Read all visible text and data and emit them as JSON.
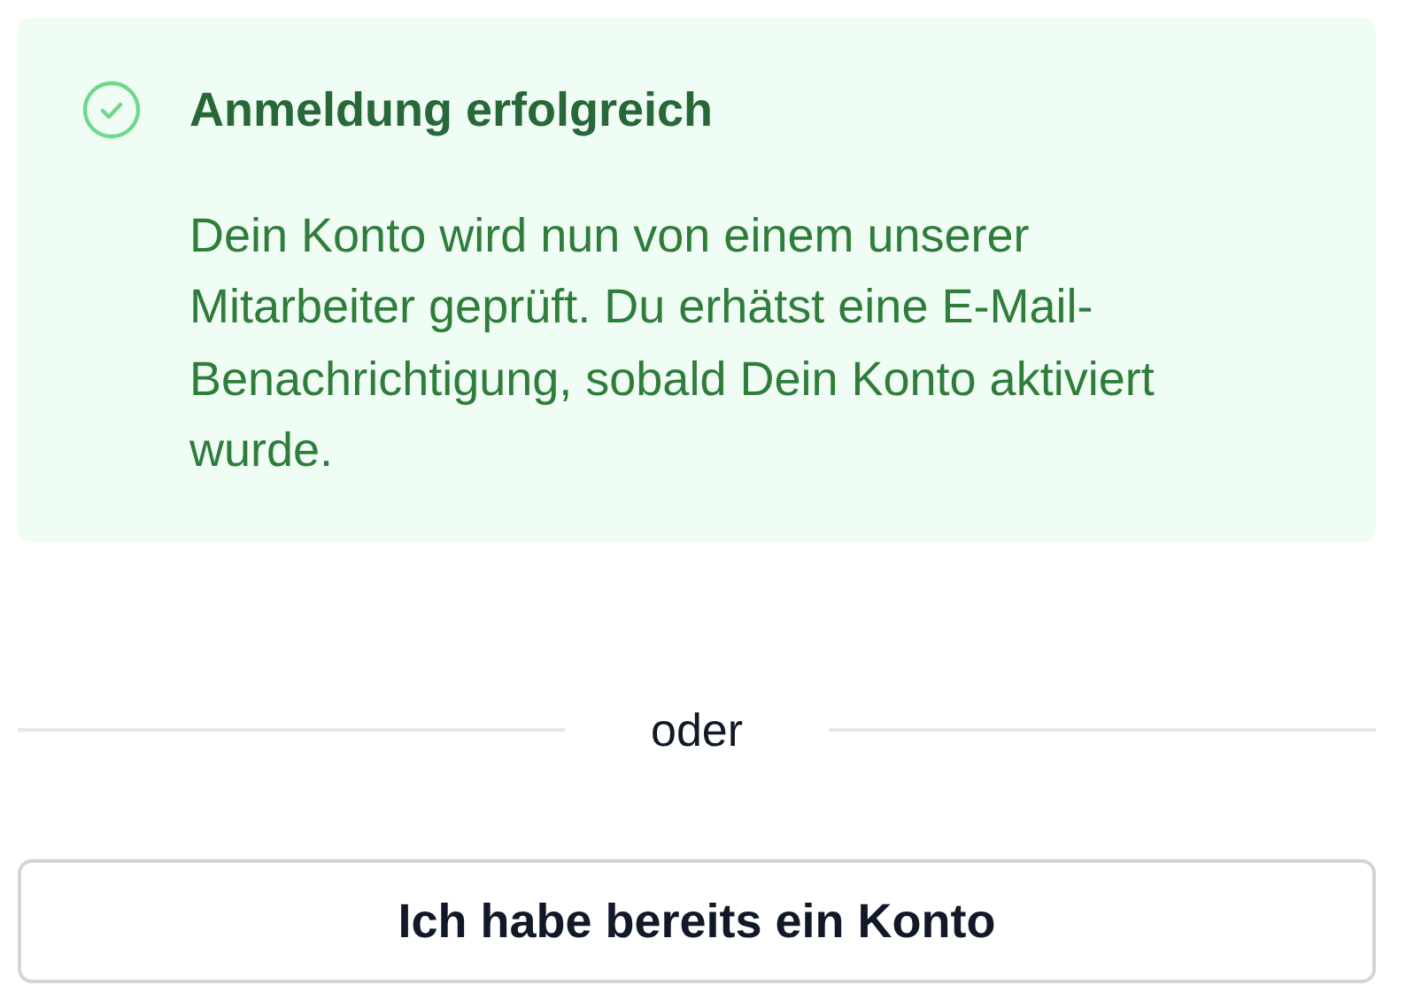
{
  "alert": {
    "kind": "success",
    "title": "Anmeldung erfolgreich",
    "message": "Dein Konto wird nun von einem unserer Mitarbeiter geprüft. Du erhätst eine E-Mail-Benachrichtigung, sobald Dein Konto aktiviert wurde."
  },
  "divider": {
    "label": "oder"
  },
  "buttons": [
    {
      "label": "Ich habe bereits ein Konto"
    }
  ]
}
